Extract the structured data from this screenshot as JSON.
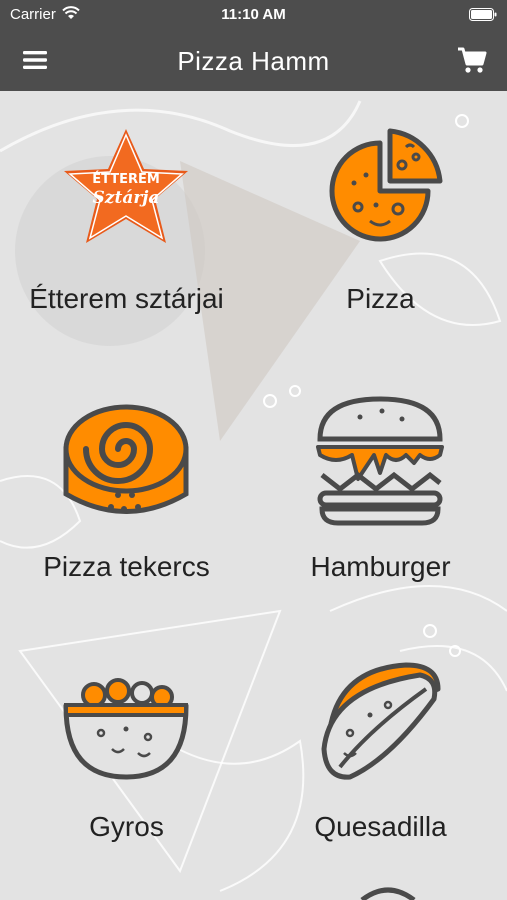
{
  "status_bar": {
    "carrier": "Carrier",
    "time": "11:10 AM",
    "icons": [
      "wifi-icon",
      "battery-icon"
    ]
  },
  "nav_bar": {
    "title": "Pizza Hamm",
    "menu_icon": "hamburger-menu-icon",
    "cart_icon": "shopping-cart-icon"
  },
  "categories": [
    {
      "label": "Étterem sztárjai",
      "icon": "star-badge-icon",
      "badge_line1": "ÉTTEREM",
      "badge_line2": "Sztárja"
    },
    {
      "label": "Pizza",
      "icon": "pizza-icon"
    },
    {
      "label": "Pizza tekercs",
      "icon": "pizza-roll-icon"
    },
    {
      "label": "Hamburger",
      "icon": "hamburger-icon"
    },
    {
      "label": "Gyros",
      "icon": "gyros-bowl-icon"
    },
    {
      "label": "Quesadilla",
      "icon": "quesadilla-icon"
    }
  ],
  "colors": {
    "bar": "#4d4d4d",
    "accent": "#ff8c00",
    "outline": "#4a4a4a",
    "background": "#e3e3e3"
  }
}
